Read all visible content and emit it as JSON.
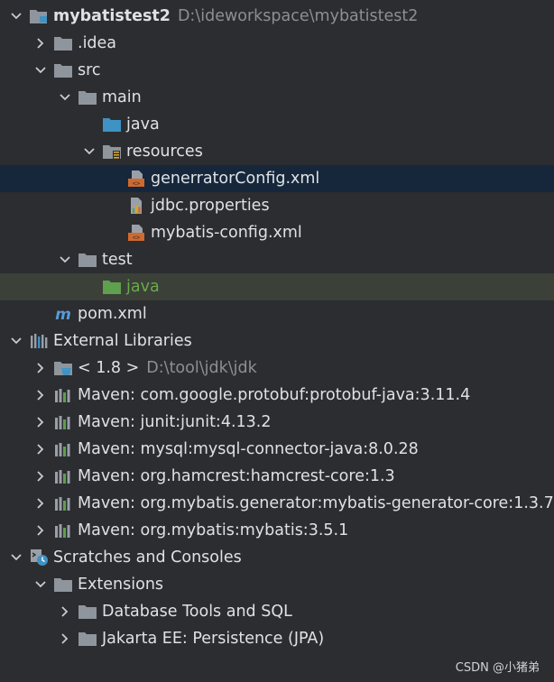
{
  "tree": {
    "project": {
      "name": "mybatistest2",
      "path": "D:\\ideworkspace\\mybatistest2"
    },
    "idea": ".idea",
    "src": "src",
    "main": "main",
    "main_java": "java",
    "resources": "resources",
    "file_generator": "generratorConfig.xml",
    "file_jdbc": "jdbc.properties",
    "file_mybatis_config": "mybatis-config.xml",
    "test": "test",
    "test_java": "java",
    "pom": "pom.xml",
    "external_libraries": "External Libraries",
    "jdk": {
      "name": "< 1.8 >",
      "path": "D:\\tool\\jdk\\jdk"
    },
    "libraries": [
      "Maven: com.google.protobuf:protobuf-java:3.11.4",
      "Maven: junit:junit:4.13.2",
      "Maven: mysql:mysql-connector-java:8.0.28",
      "Maven: org.hamcrest:hamcrest-core:1.3",
      "Maven: org.mybatis.generator:mybatis-generator-core:1.3.7",
      "Maven: org.mybatis:mybatis:3.5.1"
    ],
    "scratches": "Scratches and Consoles",
    "extensions": "Extensions",
    "ext_items": [
      "Database Tools and SQL",
      "Jakarta EE: Persistence (JPA)"
    ]
  },
  "watermark": "CSDN @小猪弟",
  "colors": {
    "background": "#2b2d30",
    "selected_row": "#16273b",
    "highlight_row": "#3b4039",
    "folder": "#8f959d",
    "source_folder": "#3f92c4",
    "test_folder": "#5fa04e",
    "xml_icon": "#d0692e"
  }
}
